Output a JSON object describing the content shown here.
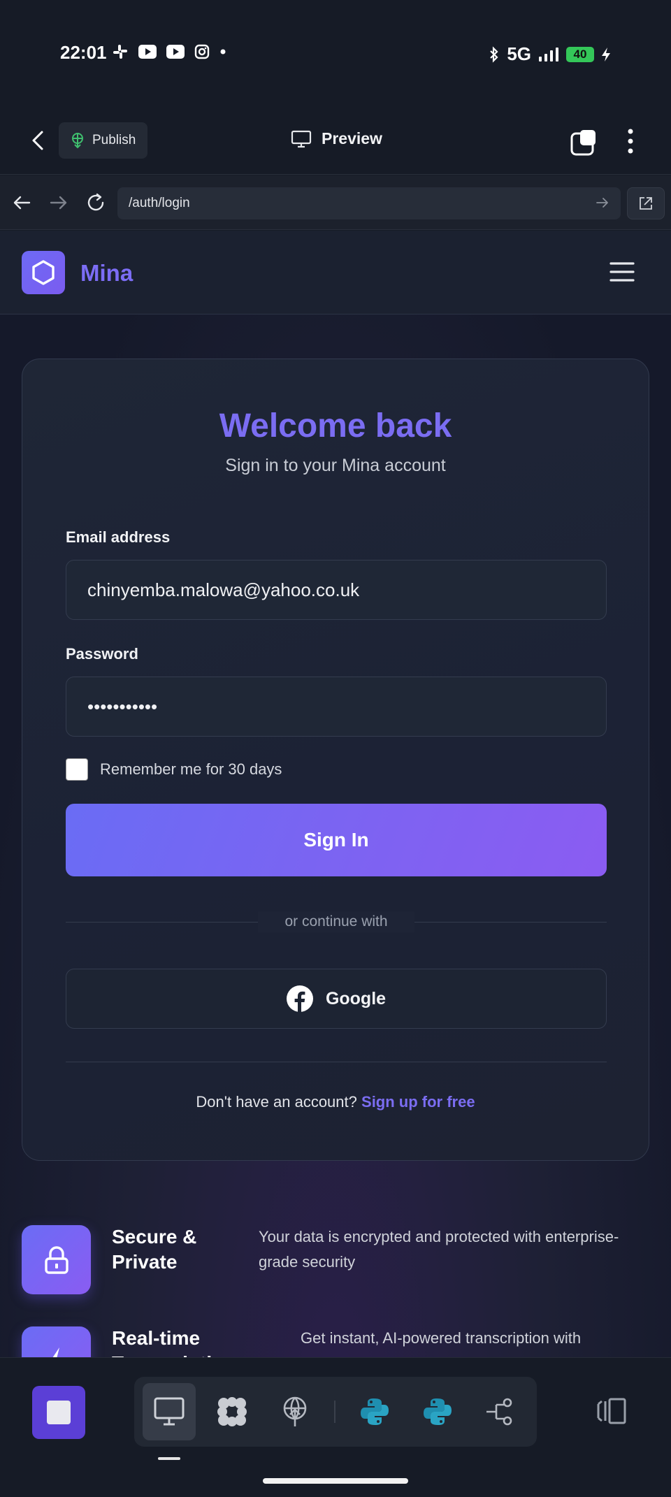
{
  "status_bar": {
    "time": "22:01",
    "network": "5G",
    "battery": "40",
    "left_icons": [
      "slack-icon",
      "youtube-icon",
      "youtube-icon",
      "instagram-icon",
      "dot-icon"
    ],
    "right_icons": [
      "bluetooth-icon",
      "signal-icon",
      "charging-icon"
    ]
  },
  "toolbar": {
    "publish_label": "Publish",
    "preview_label": "Preview"
  },
  "urlbar": {
    "url": "/auth/login"
  },
  "site": {
    "brand": "Mina"
  },
  "login": {
    "title": "Welcome back",
    "subtitle": "Sign in to your Mina account",
    "email_label": "Email address",
    "email_value": "chinyemba.malowa@yahoo.co.uk",
    "password_label": "Password",
    "password_value": "•••••••••••",
    "remember_label": "Remember me for 30 days",
    "signin_label": "Sign In",
    "divider_text": "or continue with",
    "google_label": "Google",
    "signup_prompt": "Don't have an account?",
    "signup_link": "Sign up for free"
  },
  "features": [
    {
      "title": "Secure & Private",
      "desc": "Your data is encrypted and protected with enterprise-grade security",
      "icon": "lock-icon"
    },
    {
      "title": "Real-time Transcription",
      "desc": "Get instant, AI-powered transcription with",
      "icon": "lightning-icon"
    }
  ],
  "colors": {
    "accent": "#7b6df2",
    "button_start": "#6a6cf4",
    "button_end": "#8b5cf2",
    "background": "#161b26"
  },
  "dock": {
    "items": [
      "monitor-icon",
      "flower-icon",
      "globe-upload-icon",
      "python-icon",
      "python-icon",
      "git-branch-icon"
    ]
  }
}
